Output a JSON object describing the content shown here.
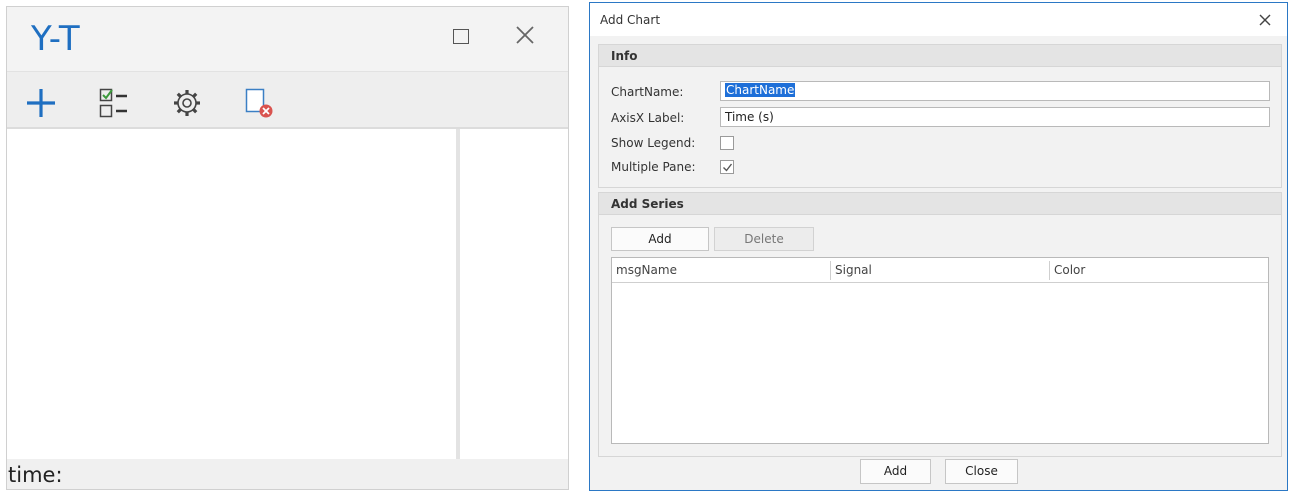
{
  "yt_window": {
    "title": "Y-T",
    "toolbar": {
      "add_icon": "plus-icon",
      "select_icon": "checklist-icon",
      "settings_icon": "gear-icon",
      "delete_icon": "delete-chart-icon"
    },
    "status": {
      "time_label": "time:"
    }
  },
  "dialog": {
    "title": "Add Chart",
    "info": {
      "header": "Info",
      "chartname_label": "ChartName:",
      "chartname_value": "ChartName",
      "axisx_label": "AxisX Label:",
      "axisx_value": "Time (s)",
      "show_legend_label": "Show Legend:",
      "show_legend_checked": false,
      "multiple_pane_label": "Multiple Pane:",
      "multiple_pane_checked": true
    },
    "series": {
      "header": "Add Series",
      "add_label": "Add",
      "delete_label": "Delete",
      "columns": [
        "msgName",
        "Signal",
        "Color"
      ],
      "rows": []
    },
    "footer": {
      "add_label": "Add",
      "close_label": "Close"
    }
  },
  "colors": {
    "title_blue": "#1f6fc1",
    "accent_blue": "#2b78c5",
    "selection_blue": "#1e6fd8",
    "delete_red": "#d9534f"
  }
}
